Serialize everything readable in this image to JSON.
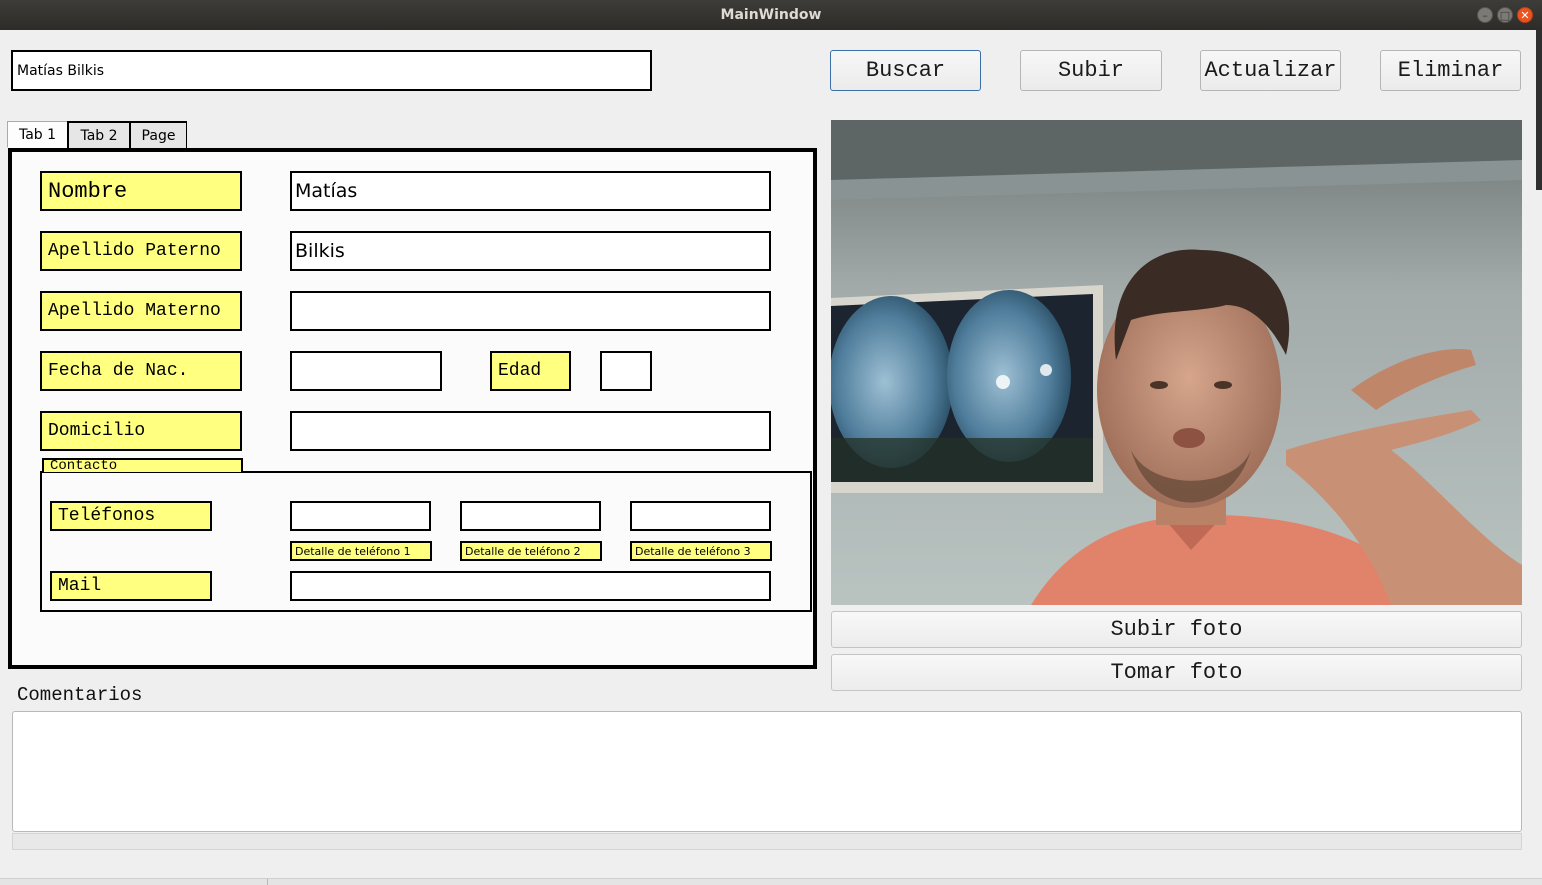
{
  "window": {
    "title": "MainWindow"
  },
  "search": {
    "value": "Matías Bilkis"
  },
  "toolbar": {
    "buscar_label": "Buscar",
    "subir_label": "Subir",
    "actualizar_label": "Actualizar",
    "eliminar_label": "Eliminar"
  },
  "tabs": [
    {
      "label": "Tab 1",
      "active": true
    },
    {
      "label": "Tab 2",
      "active": false
    },
    {
      "label": "Page",
      "active": false
    }
  ],
  "form": {
    "nombre_label": "Nombre",
    "nombre_value": "Matías",
    "apellido_paterno_label": "Apellido Paterno",
    "apellido_paterno_value": "Bilkis",
    "apellido_materno_label": "Apellido Materno",
    "apellido_materno_value": "",
    "fecha_nac_label": "Fecha de Nac.",
    "fecha_nac_value": "",
    "edad_label": "Edad",
    "edad_value": "",
    "domicilio_label": "Domicilio",
    "domicilio_value": ""
  },
  "contacto": {
    "title": "Contacto",
    "telefonos_label": "Teléfonos",
    "telefono_detalles": [
      "Detalle de teléfono 1",
      "Detalle de teléfono 2",
      "Detalle de teléfono 3"
    ],
    "mail_label": "Mail"
  },
  "photo_buttons": {
    "subir_foto": "Subir  foto",
    "tomar_foto": "Tomar  foto"
  },
  "comentarios": {
    "label": "Comentarios",
    "value": ""
  },
  "colors": {
    "label_bg": "#ffff80",
    "titlebar": "#333230",
    "close_button": "#e95420"
  }
}
